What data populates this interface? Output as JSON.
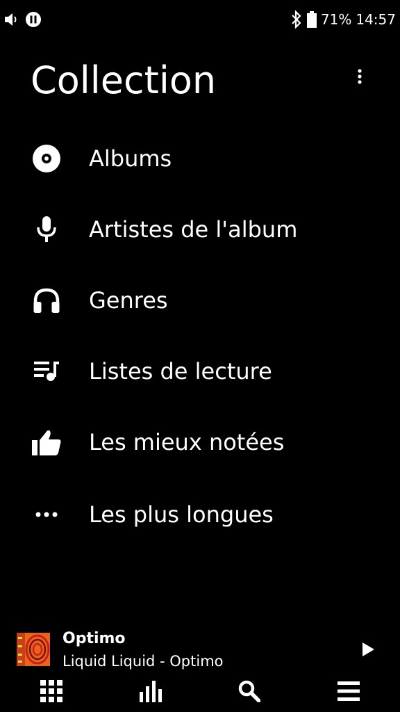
{
  "status_bar": {
    "battery_percent": "71%",
    "time": "14:57",
    "icons": [
      "volume-icon",
      "pause-circle-icon",
      "bluetooth-icon",
      "battery-icon"
    ]
  },
  "header": {
    "title": "Collection",
    "overflow_icon": "more-vert-icon"
  },
  "menu": {
    "items": [
      {
        "label": "Albums",
        "icon": "album-disc-icon"
      },
      {
        "label": "Artistes de l'album",
        "icon": "microphone-icon"
      },
      {
        "label": "Genres",
        "icon": "headphones-icon"
      },
      {
        "label": "Listes de lecture",
        "icon": "playlist-icon"
      },
      {
        "label": "Les mieux notées",
        "icon": "thumb-up-icon"
      },
      {
        "label": "Les plus longues",
        "icon": "more-horiz-icon"
      }
    ]
  },
  "now_playing": {
    "title": "Optimo",
    "subtitle": "Liquid Liquid - Optimo",
    "play_icon": "play-icon"
  },
  "bottom_nav": {
    "items": [
      {
        "icon": "grid-icon"
      },
      {
        "icon": "bar-chart-icon"
      },
      {
        "icon": "search-icon"
      },
      {
        "icon": "menu-icon"
      }
    ]
  },
  "colors": {
    "background": "#000000",
    "foreground": "#ffffff",
    "album_art_orange": "#e8661c",
    "album_art_red": "#c81e1e"
  }
}
